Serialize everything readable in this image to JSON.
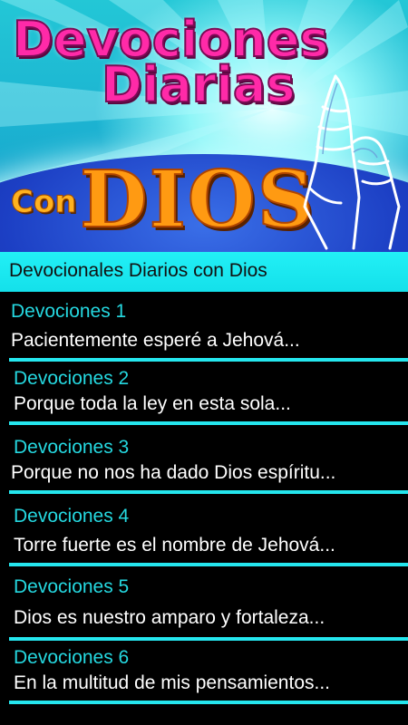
{
  "banner": {
    "title_line1": "Devociones",
    "title_line2": "Diarias",
    "con": "Con",
    "dios": "DIOS"
  },
  "header": {
    "title": "Devocionales Diarios con Dios"
  },
  "items": [
    {
      "title": "Devociones 1",
      "subtitle": "Pacientemente esperé a Jehová..."
    },
    {
      "title": "Devociones 2",
      "subtitle": "Porque toda la ley en esta sola..."
    },
    {
      "title": "Devociones 3",
      "subtitle": "Porque no nos ha dado Dios espíritu..."
    },
    {
      "title": "Devociones 4",
      "subtitle": "Torre fuerte es el nombre de Jehová..."
    },
    {
      "title": "Devociones 5",
      "subtitle": "Dios es nuestro amparo y fortaleza..."
    },
    {
      "title": "Devociones 6",
      "subtitle": "En la multitud de mis pensamientos..."
    }
  ],
  "colors": {
    "accent": "#25e6ee",
    "title_pink": "#ff2aa8",
    "dios_orange": "#ff9a12"
  }
}
